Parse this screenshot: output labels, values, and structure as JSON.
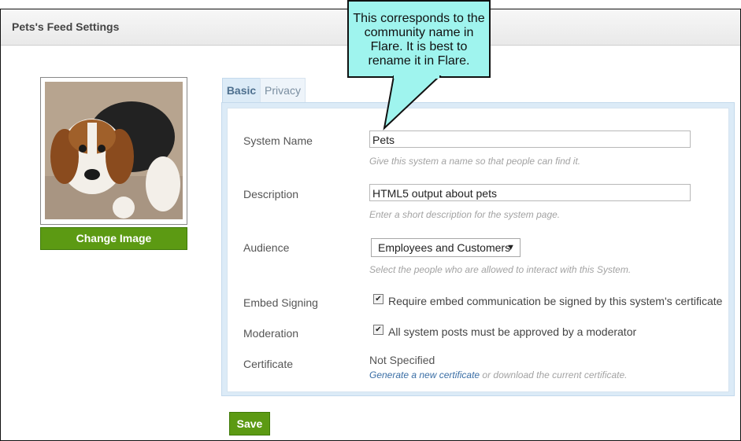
{
  "header": {
    "title": "Pets's Feed Settings"
  },
  "avatar": {
    "change_label": "Change Image"
  },
  "tabs": [
    {
      "label": "Basic"
    },
    {
      "label": "Privacy"
    }
  ],
  "form": {
    "system_name": {
      "label": "System Name",
      "value": "Pets",
      "hint": "Give this system a name so that people can find it."
    },
    "description": {
      "label": "Description",
      "value": "HTML5 output about pets",
      "hint": "Enter a short description for the system page."
    },
    "audience": {
      "label": "Audience",
      "selected": "Employees and Customers",
      "hint": "Select the people who are allowed to interact with this System."
    },
    "embed_signing": {
      "label": "Embed Signing",
      "checkbox_label": "Require embed communication be signed by this system's certificate",
      "checked": true
    },
    "moderation": {
      "label": "Moderation",
      "checkbox_label": "All system posts must be approved by a moderator",
      "checked": true
    },
    "certificate": {
      "label": "Certificate",
      "value": "Not Specified",
      "link_text": "Generate a new certificate",
      "suffix_text": " or download the current certificate."
    }
  },
  "save_label": "Save",
  "callout": {
    "text_lines": [
      "This corresponds to the",
      "community name in",
      "Flare. It is best to",
      "rename it in Flare."
    ]
  },
  "colors": {
    "accent_green": "#5c9a13",
    "tab_blue": "#dcebf7",
    "callout": "#9ff4ee"
  }
}
